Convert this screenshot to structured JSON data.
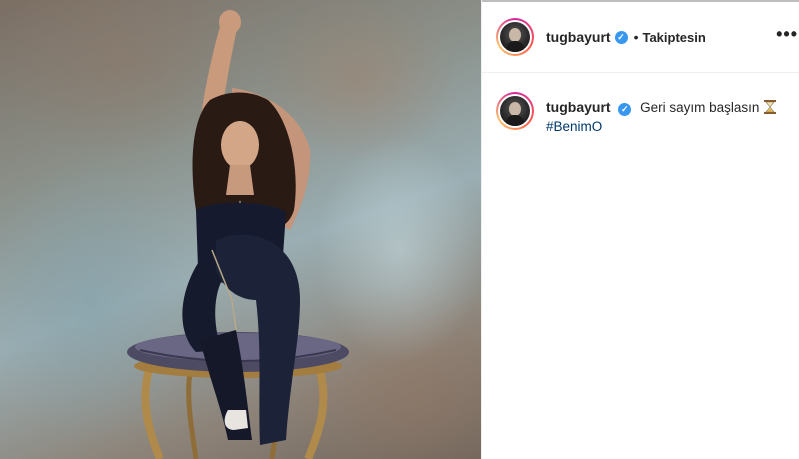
{
  "post": {
    "author": {
      "username": "tugbayurt",
      "verified": true,
      "follow_separator": "•",
      "follow_label": "Takiptesin"
    },
    "more_label": "•••",
    "caption": {
      "username": "tugbayurt",
      "text": "Geri sayım başlasın",
      "emoji_icon": "hourglass-icon",
      "hashtag": "#BenimO"
    }
  },
  "colors": {
    "verified_blue": "#3897f0",
    "hashtag_blue": "#00376b",
    "text": "#262626",
    "border": "#efefef"
  }
}
